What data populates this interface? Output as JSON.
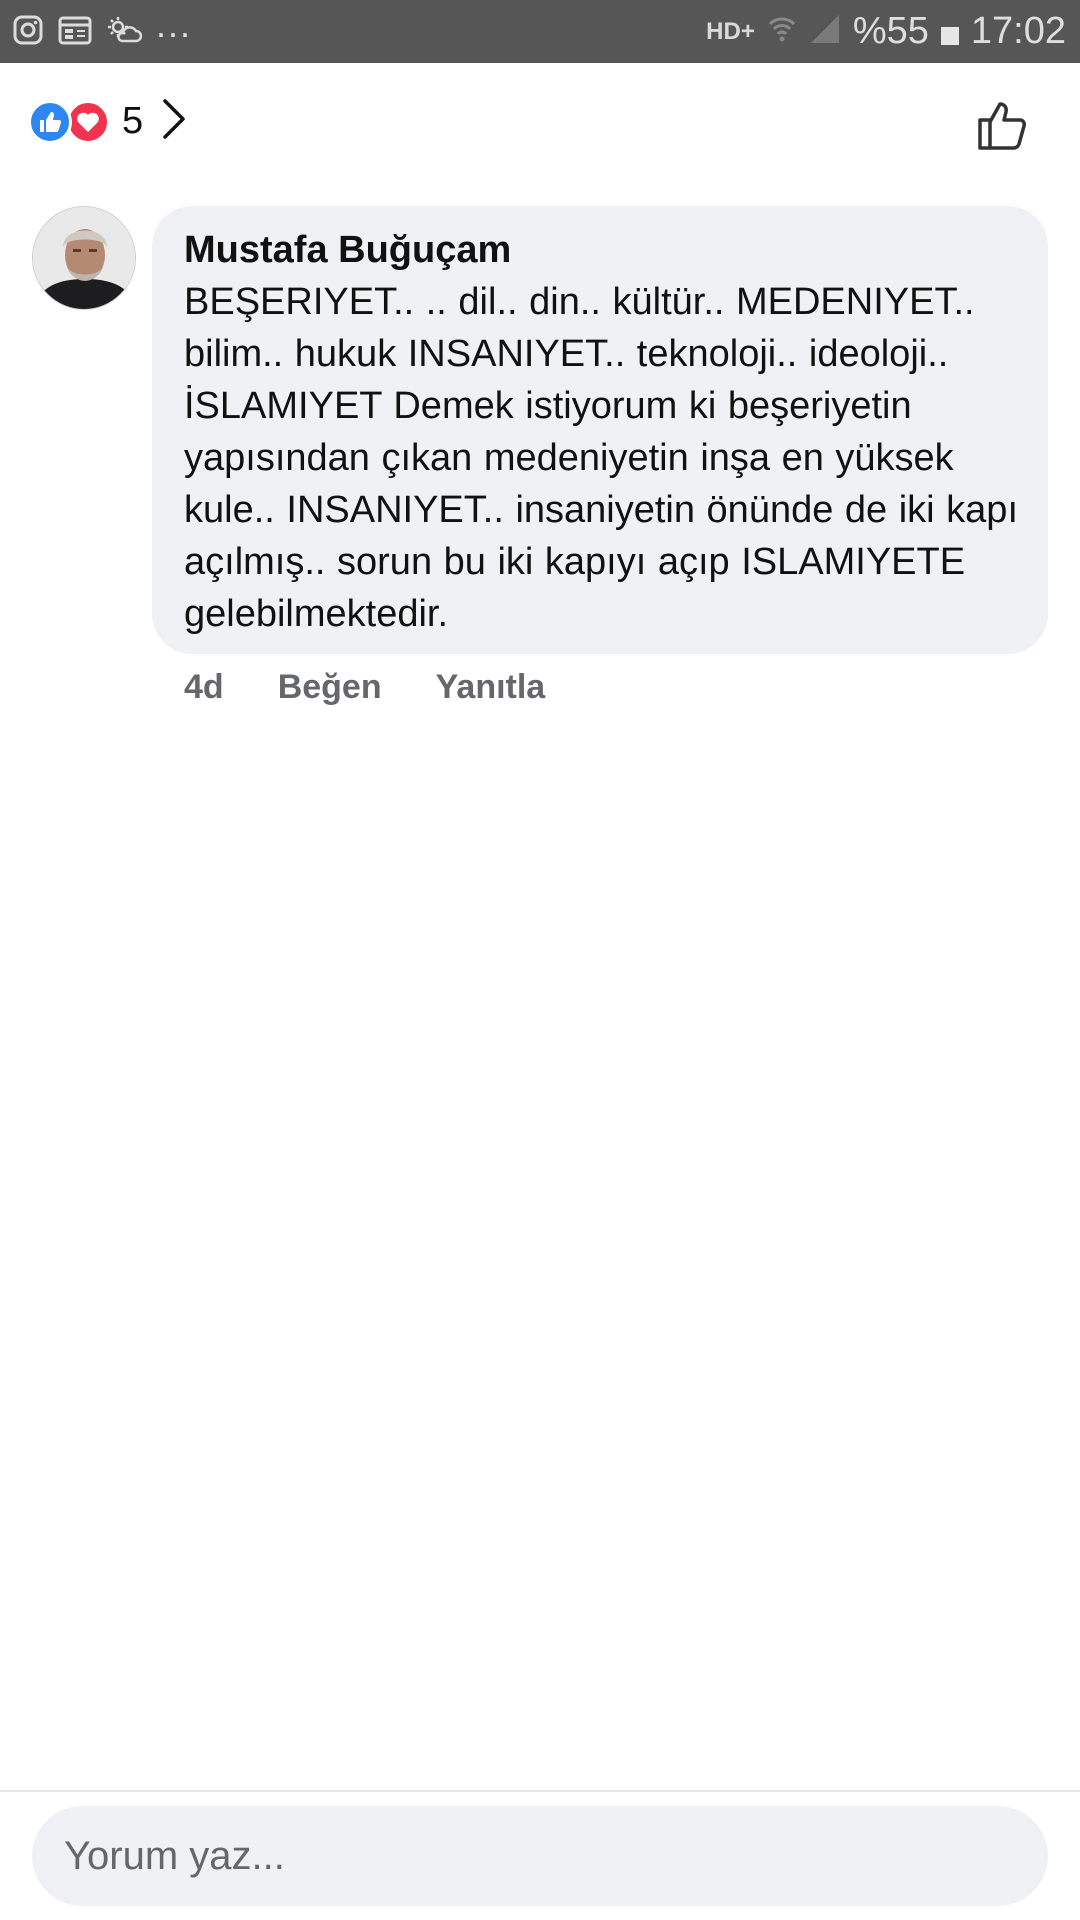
{
  "status_bar": {
    "dots": "...",
    "network": "HD+",
    "battery": "%55",
    "time": "17:02",
    "icons": [
      "instagram-icon",
      "calendar-icon",
      "weather-icon",
      "wifi-icon",
      "signal-icon",
      "battery-icon"
    ]
  },
  "reactions": {
    "count": "5",
    "types": [
      "like",
      "love"
    ]
  },
  "comment": {
    "author": "Mustafa Buğuçam",
    "text": "BEŞERIYET.. .. dil.. din..  kültür..  MEDENIYET.. bilim.. hukuk  INSANIYET.. teknoloji.. ideoloji..  İSLAMIYET Demek istiyorum ki beşeriyetin yapısından çıkan medeniyetin inşa en yüksek kule.. INSANIYET..  insaniyetin önünde de iki kapı açılmış..  sorun bu iki kapıyı açıp ISLAMIYETE gelebilmektedir.",
    "time_ago": "4d",
    "like_label": "Beğen",
    "reply_label": "Yanıtla"
  },
  "composer": {
    "placeholder": "Yorum yaz..."
  },
  "colors": {
    "status_bar_bg": "#565656",
    "like_blue": "#2e86f2",
    "love_red": "#f0334f",
    "bubble_bg": "#f0f1f4",
    "meta_gray": "#65676b"
  }
}
